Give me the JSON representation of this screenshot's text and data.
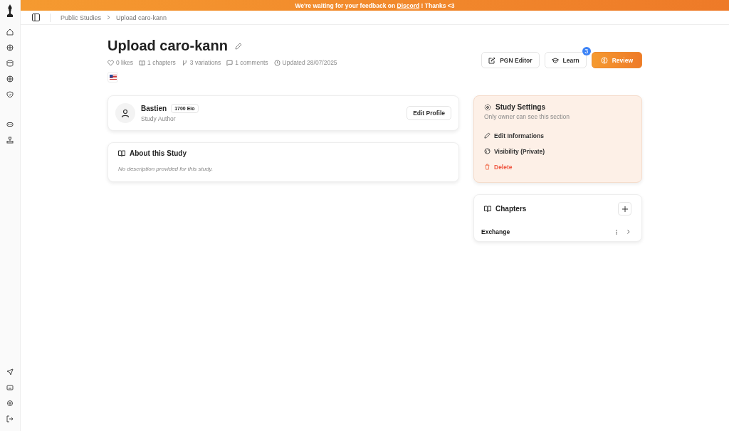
{
  "banner": {
    "before": "We're waiting for your feedback on",
    "link": "Discord",
    "after": "! Thanks <3"
  },
  "breadcrumbs": [
    {
      "label": "Public Studies"
    },
    {
      "label": "Upload caro-kann"
    }
  ],
  "study": {
    "title": "Upload caro-kann",
    "stats": [
      {
        "kind": "likes",
        "text": "0 likes"
      },
      {
        "kind": "chapters",
        "text": "1 chapters"
      },
      {
        "kind": "variations",
        "text": "3 variations"
      },
      {
        "kind": "comments",
        "text": "1 comments"
      },
      {
        "kind": "updated",
        "text": "Updated 28/07/2025"
      }
    ]
  },
  "actions": [
    {
      "kind": "pgn",
      "label": "PGN Editor"
    },
    {
      "kind": "learn",
      "label": "Learn",
      "badge": "3"
    },
    {
      "kind": "review",
      "label": "Review"
    }
  ],
  "author": {
    "name": "Bastien",
    "elo": "1700 Elo",
    "role": "Study Author",
    "button": "Edit Profile"
  },
  "about": {
    "title": "About this Study",
    "text": "No description provided for this study."
  },
  "settings": {
    "title": "Study Settings",
    "subtitle": "Only owner can see this section",
    "items": [
      {
        "kind": "edit",
        "label": "Edit Informations"
      },
      {
        "kind": "visibility",
        "label": "Visibility (Private)"
      },
      {
        "kind": "delete",
        "label": "Delete"
      }
    ]
  },
  "chapters": {
    "title": "Chapters",
    "items": [
      {
        "name": "Exchange"
      }
    ]
  }
}
